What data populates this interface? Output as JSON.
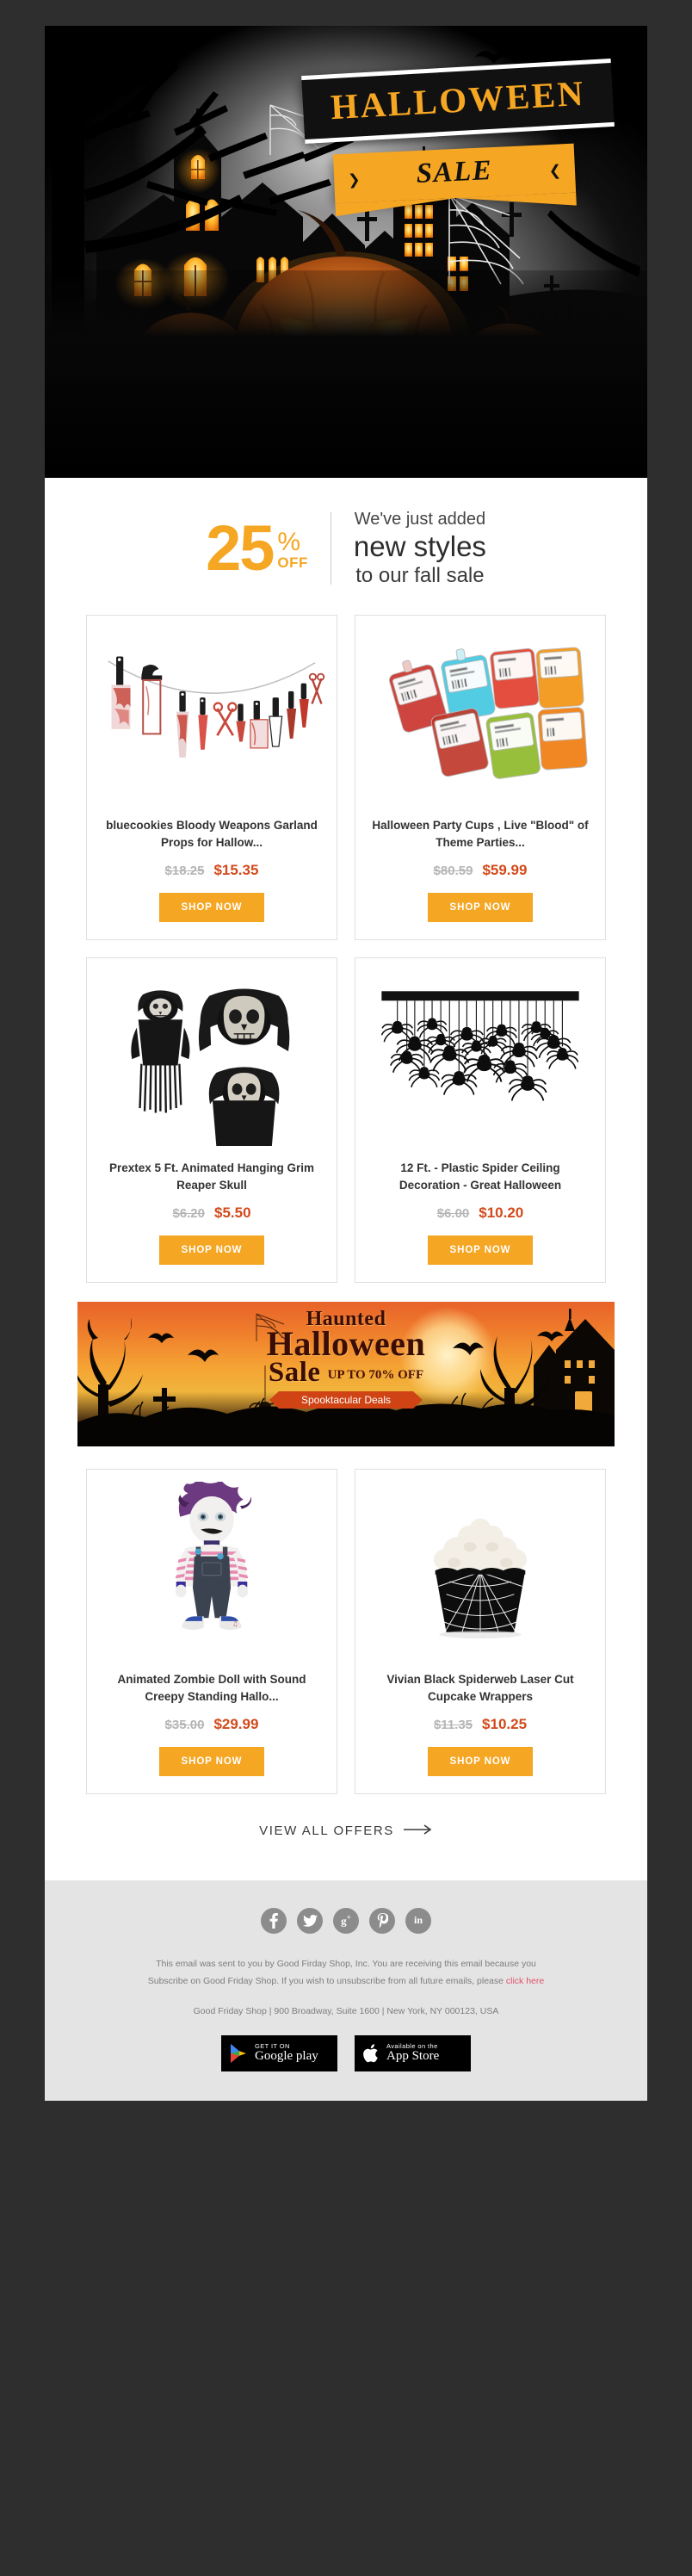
{
  "hero": {
    "sign_top": "HALLOWEEN",
    "sign_bottom": "SALE",
    "bat_left": "❯",
    "bat_right": "❮"
  },
  "promo": {
    "number": "25",
    "percent": "%",
    "off": "OFF",
    "line1": "We've just added",
    "line2": "new styles",
    "line3": "to our fall sale"
  },
  "products": [
    {
      "title": "bluecookies Bloody Weapons Garland  Props for Hallow...",
      "price_old": "$18.25",
      "price_new": "$15.35",
      "button": "SHOP NOW",
      "image_name": "bloody-weapons-garland-image"
    },
    {
      "title": "Halloween Party Cups , Live \"Blood\" of Theme Parties...",
      "price_old": "$80.59",
      "price_new": "$59.99",
      "button": "SHOP NOW",
      "image_name": "blood-bag-party-cups-image"
    },
    {
      "title": "Prextex 5 Ft. Animated Hanging Grim Reaper Skull",
      "price_old": "$6.20",
      "price_new": "$5.50",
      "button": "SHOP NOW",
      "image_name": "grim-reaper-skull-image"
    },
    {
      "title": "12 Ft. - Plastic Spider Ceiling Decoration - Great Halloween",
      "price_old": "$6.00",
      "price_new": "$10.20",
      "button": "SHOP NOW",
      "image_name": "plastic-spider-ceiling-image"
    },
    {
      "title": "Animated Zombie Doll with Sound Creepy Standing Hallo...",
      "price_old": "$35.00",
      "price_new": "$29.99",
      "button": "SHOP NOW",
      "image_name": "animated-zombie-doll-image"
    },
    {
      "title": "Vivian Black Spiderweb Laser Cut Cupcake Wrappers",
      "price_old": "$11.35",
      "price_new": "$10.25",
      "button": "SHOP NOW",
      "image_name": "spiderweb-cupcake-wrappers-image"
    }
  ],
  "mid_banner": {
    "line1": "Haunted",
    "line2": "Halloween",
    "line3": "Sale",
    "upto": "UP TO 70% OFF",
    "ribbon": "Spooktacular Deals"
  },
  "view_all": {
    "label": "VIEW ALL OFFERS",
    "arrow": "→"
  },
  "footer": {
    "socials": [
      {
        "name": "facebook-icon",
        "glyph": "f"
      },
      {
        "name": "twitter-icon",
        "glyph": "🐦"
      },
      {
        "name": "google-plus-icon",
        "glyph": "g+"
      },
      {
        "name": "pinterest-icon",
        "glyph": "𝒫"
      },
      {
        "name": "linkedin-icon",
        "glyph": "in"
      }
    ],
    "legal_line1": "This email was sent to you by Good Firday Shop, Inc. You are receiving this email because you",
    "legal_line2_pre": "Subscribe on Good Friday Shop. If you wish to unsubscribe from all future emails, please ",
    "legal_link": "click here",
    "address": "Good Friday Shop | 900 Broadway, Suite 1600 | New York, NY 000123, USA",
    "google_play_small": "GET IT ON",
    "google_play_big": "Google play",
    "app_store_small": "Available on the",
    "app_store_big": "App Store"
  },
  "colors": {
    "accent_orange": "#f5a623",
    "price_red": "#d24a1b",
    "link_pink": "#e0536a",
    "page_bg": "#2e2e2e",
    "footer_bg": "#e4e4e4"
  }
}
